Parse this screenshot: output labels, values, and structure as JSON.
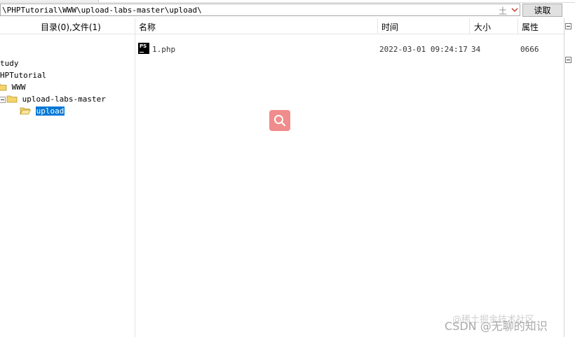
{
  "address_bar": {
    "path": "\\PHPTutorial\\WWW\\upload-labs-master\\upload\\",
    "ime_glyph": "土",
    "read_button": "读取"
  },
  "header": {
    "tree_summary": "目录(0),文件(1)",
    "col_name": "名称",
    "col_time": "时间",
    "col_size": "大小",
    "col_attr": "属性"
  },
  "tree": {
    "nodes": [
      {
        "label": "tudy"
      },
      {
        "label": "HPTutorial"
      },
      {
        "label": "WWW"
      },
      {
        "label": "upload-labs-master"
      },
      {
        "label": "upload",
        "selected": true
      }
    ]
  },
  "files": [
    {
      "icon": "PS",
      "name": "1.php",
      "time": "2022-03-01 09:24:17",
      "size": "34",
      "attr": "0666"
    }
  ],
  "watermark": {
    "line1": "@稀土掘金技术社区",
    "line2": "CSDN @无聊的知识"
  },
  "colors": {
    "selection": "#0078d7",
    "search_overlay": "#f08c8c",
    "folder": "#f5d36b"
  }
}
